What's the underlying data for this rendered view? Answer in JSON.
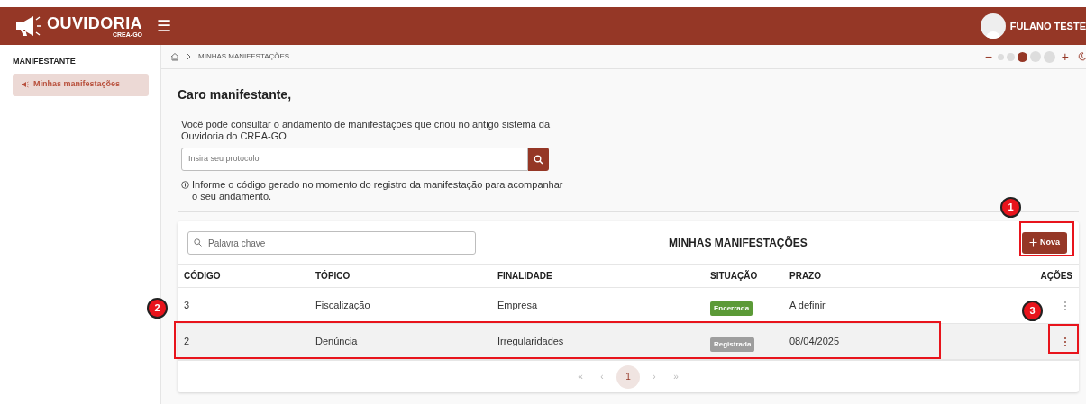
{
  "header": {
    "logo_title": "OUVIDORIA",
    "logo_subtitle": "CREA-GO",
    "menu_icon": "☰",
    "user_name": "FULANO TESTE"
  },
  "sidebar": {
    "section": "MANIFESTANTE",
    "items": [
      {
        "label": "Minhas manifestações",
        "selected": true
      }
    ]
  },
  "breadcrumb": {
    "items": [
      "MINHAS MANIFESTAÇÕES"
    ]
  },
  "toolbar": {
    "zoom_minus": "−",
    "zoom_plus": "+",
    "zoom_levels": [
      {
        "selected": false
      },
      {
        "selected": false
      },
      {
        "selected": true
      },
      {
        "selected": false
      },
      {
        "selected": false
      }
    ]
  },
  "intro": {
    "title": "Caro manifestante,",
    "text": "Você pode consultar o andamento de manifestações que criou no antigo sistema da Ouvidoria do CREA-GO",
    "protocol_field": {
      "placeholder": "Insira seu protocolo"
    },
    "hint": "Informe o código gerado no momento do registro da manifestação para acompanhar o seu andamento."
  },
  "table": {
    "search": {
      "placeholder": "Palavra chave"
    },
    "title": "MINHAS MANIFESTAÇÕES",
    "new_button": "Nova",
    "columns": [
      "CÓDIGO",
      "TÓPICO",
      "FINALIDADE",
      "SITUAÇÃO",
      "PRAZO",
      "AÇÕES"
    ],
    "rows": [
      {
        "codigo": "3",
        "topico": "Fiscalização",
        "finalidade": "Empresa",
        "situacao": {
          "label": "Encerrada",
          "color": "#5b9a37"
        },
        "prazo": "A definir",
        "selected": false
      },
      {
        "codigo": "2",
        "topico": "Denúncia",
        "finalidade": "Irregularidades",
        "situacao": {
          "label": "Registrada",
          "color": "#9e9e9e"
        },
        "prazo": "08/04/2025",
        "selected": true
      }
    ],
    "pagination": {
      "first": "«",
      "prev": "‹",
      "pages": [
        {
          "label": "1",
          "selected": true
        }
      ],
      "next": "›",
      "last": "»"
    }
  },
  "annotations": [
    {
      "number": "1"
    },
    {
      "number": "2"
    },
    {
      "number": "3"
    }
  ]
}
